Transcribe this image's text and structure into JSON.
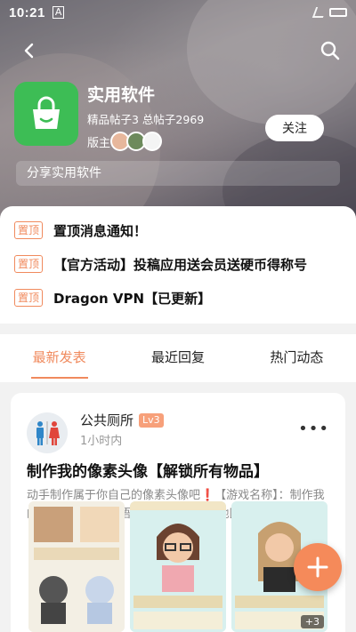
{
  "status_bar": {
    "time": "10:21",
    "indicator": "A"
  },
  "header": {
    "board_name": "实用软件",
    "stats": "精品帖子3 总帖子2969",
    "moderators_label": "版主:",
    "follow_label": "关注",
    "description": "分享实用软件"
  },
  "pinned": [
    {
      "tag": "置顶",
      "text": "置顶消息通知！"
    },
    {
      "tag": "置顶",
      "text": "【官方活动】投稿应用送会员送硬币得称号"
    },
    {
      "tag": "置顶",
      "text": "Dragon VPN【已更新】"
    }
  ],
  "tabs": [
    {
      "label": "最新发表",
      "active": true
    },
    {
      "label": "最近回复",
      "active": false
    },
    {
      "label": "热门动态",
      "active": false
    }
  ],
  "post": {
    "author": "公共厕所",
    "level": "Lv3",
    "time": "1小时内",
    "title": "制作我的像素头像【解锁所有物品】",
    "excerpt": "动手制作属于你自己的像素头像吧❗【游戏名称】：制作我的像素头像【游戏语言】：中文【游戏地区】：海外",
    "extra_images": "+3"
  },
  "colors": {
    "accent": "#f08a5d",
    "app_icon": "#3dbd55",
    "fab": "#f58a5a"
  },
  "icons": [
    "back-icon",
    "search-icon",
    "shopping-bag-icon",
    "more-icon",
    "add-icon"
  ]
}
